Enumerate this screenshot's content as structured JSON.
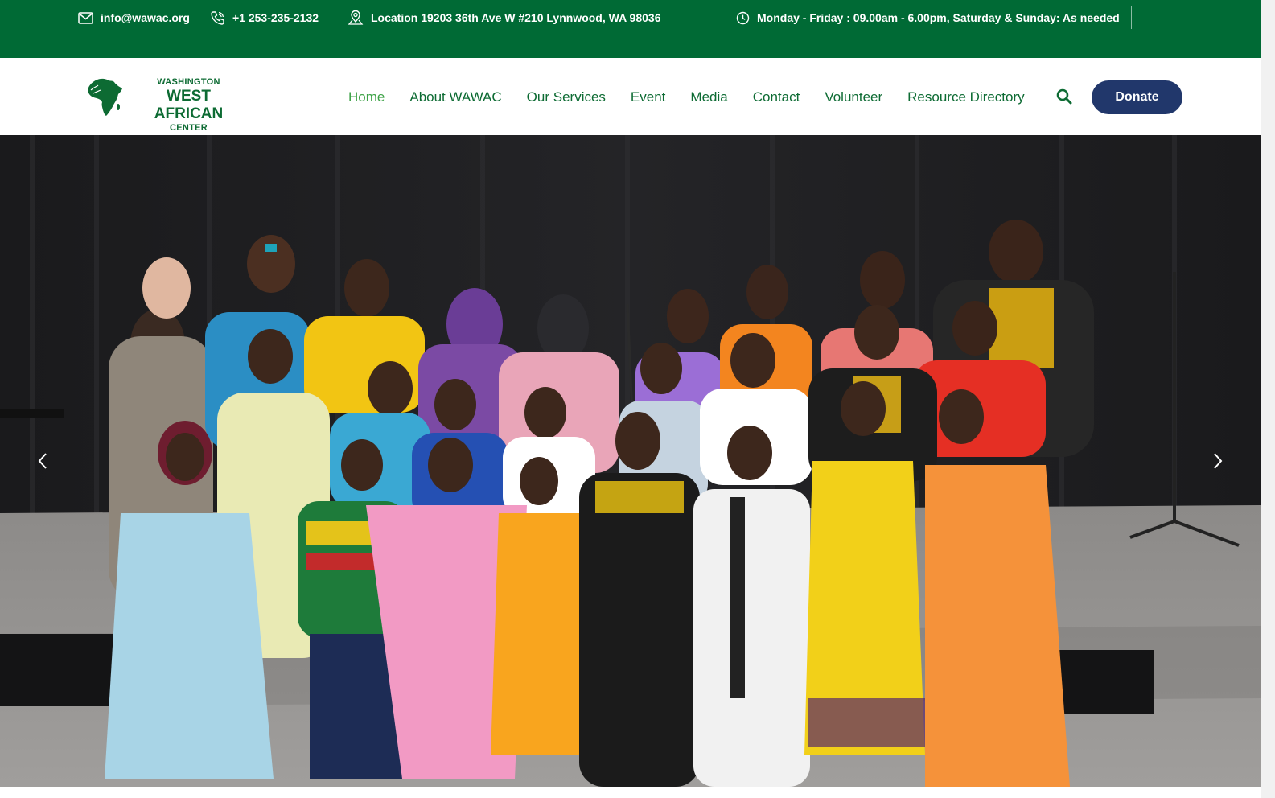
{
  "topbar": {
    "email": "info@wawac.org",
    "phone": "+1 253-235-2132",
    "location": "Location 19203 36th Ave W #210 Lynnwood, WA 98036",
    "hours": "Monday - Friday : 09.00am - 6.00pm, Saturday & Sunday: As needed"
  },
  "logo": {
    "line1": "WASHINGTON",
    "line2": "WEST AFRICAN",
    "line3": "CENTER"
  },
  "nav": {
    "items": [
      {
        "label": "Home",
        "active": true
      },
      {
        "label": "About WAWAC"
      },
      {
        "label": "Our Services"
      },
      {
        "label": "Event"
      },
      {
        "label": "Media"
      },
      {
        "label": "Contact"
      },
      {
        "label": "Volunteer"
      },
      {
        "label": "Resource Directory"
      }
    ]
  },
  "donate_label": "Donate",
  "icons": {
    "email": "envelope-icon",
    "phone": "phone-icon",
    "location": "map-pin-icon",
    "hours": "clock-icon",
    "search": "search-icon",
    "prev": "chevron-left-icon",
    "next": "chevron-right-icon"
  },
  "colors": {
    "topbar_bg": "#006a35",
    "brand_green": "#0d6b33",
    "nav_active": "#3fa348",
    "donate_bg": "#21376b"
  }
}
